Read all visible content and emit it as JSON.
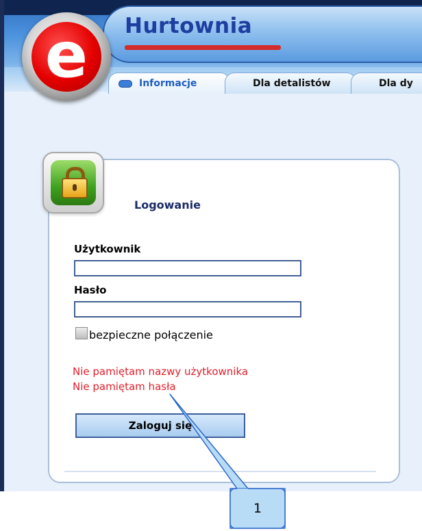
{
  "header": {
    "title": "Hurtownia",
    "tabs": [
      {
        "label": "Informacje",
        "active": true
      },
      {
        "label": "Dla detalistów",
        "active": false
      },
      {
        "label": "Dla dy",
        "active": false
      }
    ]
  },
  "logo": {
    "letter": "e"
  },
  "login": {
    "title": "Logowanie",
    "username_label": "Użytkownik",
    "username_value": "",
    "password_label": "Hasło",
    "password_value": "",
    "secure_label": "bezpieczne połączenie",
    "secure_checked": false,
    "forgot_username": "Nie pamiętam nazwy użytkownika",
    "forgot_password": "Nie pamiętam hasła",
    "button_label": "Zaloguj się"
  },
  "callout": {
    "label": "1"
  },
  "colors": {
    "header_blue": "#4d93de",
    "title_blue": "#1e3ea0",
    "link_red": "#e01e2a",
    "button_blue": "#a9cdf0",
    "callout_fill": "#b8dbf6"
  }
}
